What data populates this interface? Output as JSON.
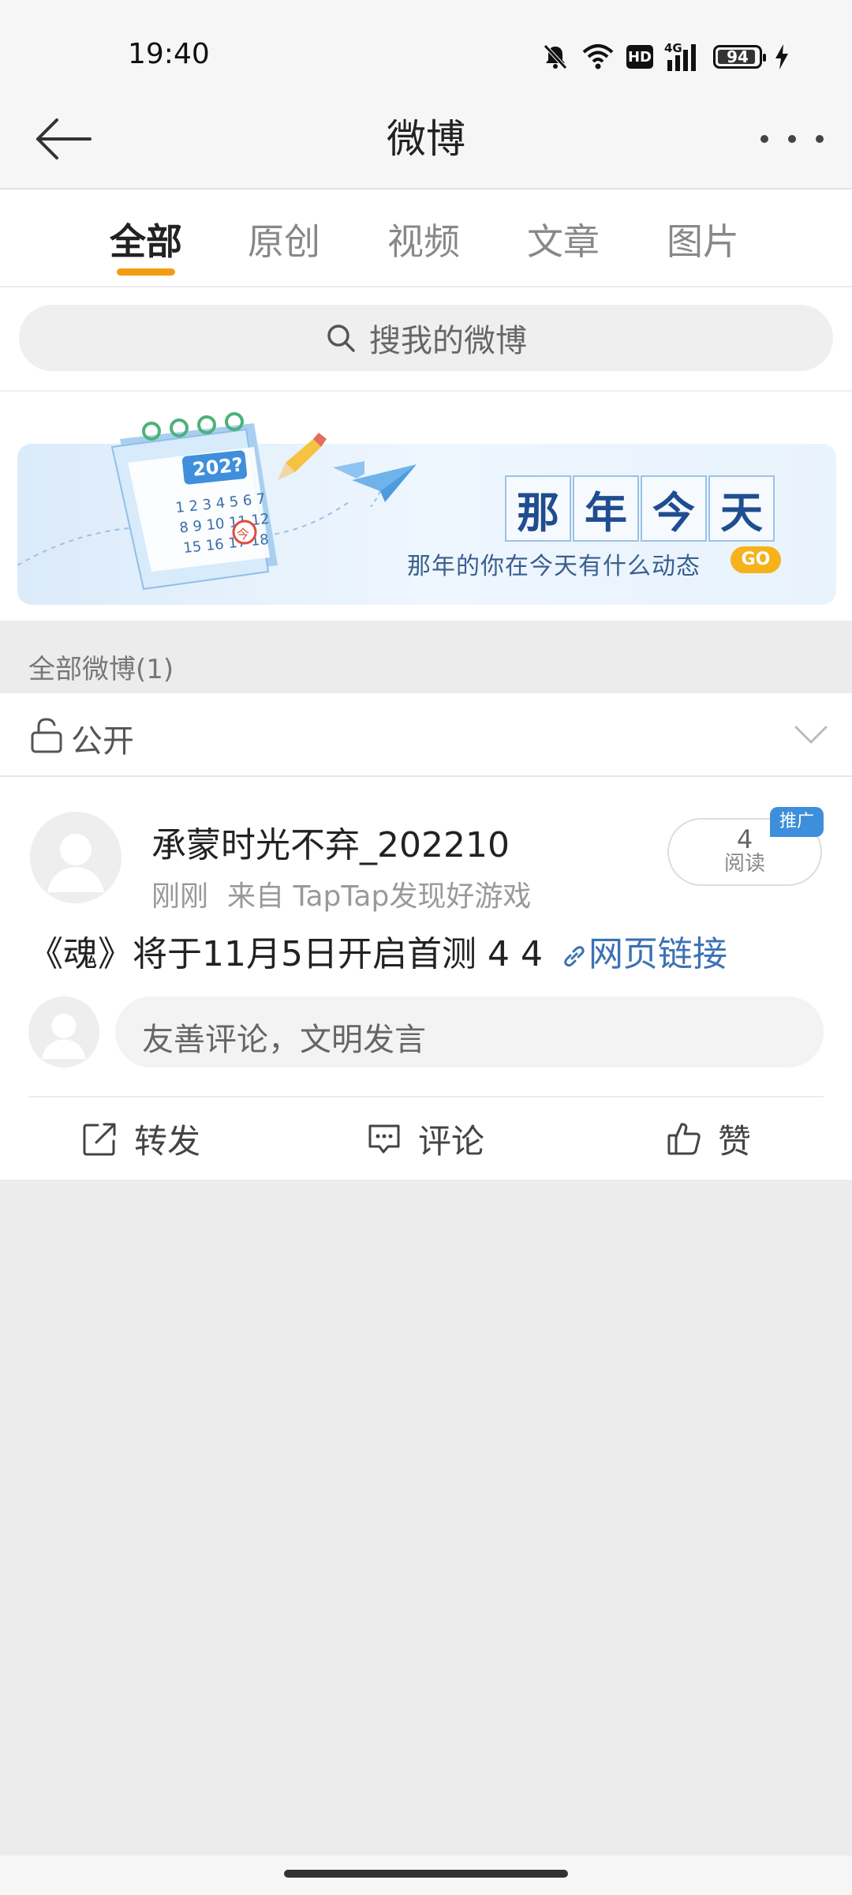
{
  "status_bar": {
    "time": "19:40",
    "battery_level": "94",
    "battery_fraction": 0.94,
    "network": "4G",
    "hd_label": "HD",
    "icons": [
      "mute-icon",
      "wifi-icon",
      "hd-icon",
      "signal-icon",
      "battery-icon",
      "charging-icon"
    ]
  },
  "nav": {
    "title": "微博",
    "back_icon": "arrow-left-icon",
    "more_icon": "more-dots-icon"
  },
  "tabs": [
    {
      "label": "全部",
      "active": true
    },
    {
      "label": "原创",
      "active": false
    },
    {
      "label": "视频",
      "active": false
    },
    {
      "label": "文章",
      "active": false
    },
    {
      "label": "图片",
      "active": false
    }
  ],
  "accent_color": "#f39c12",
  "search": {
    "placeholder": "搜我的微博"
  },
  "banner": {
    "title_chars": [
      "那",
      "年",
      "今",
      "天"
    ],
    "slogan": "那年的你在今天有什么动态",
    "go_label": "GO",
    "calendar_year": "202?",
    "calendar_today": "今"
  },
  "section": {
    "header": "全部微博(1)"
  },
  "visibility": {
    "label": "公开"
  },
  "post": {
    "author": "承蒙时光不弃_202210",
    "time": "刚刚",
    "source": "来自 TapTap发现好游戏",
    "reads_count": "4",
    "reads_label": "阅读",
    "promo_tag": "推广",
    "content": "《魂》将于11月5日开启首测 4 4 ",
    "link_text": "网页链接",
    "comment_placeholder": "友善评论，文明发言",
    "actions": {
      "repost": "转发",
      "comment": "评论",
      "like": "赞"
    }
  }
}
